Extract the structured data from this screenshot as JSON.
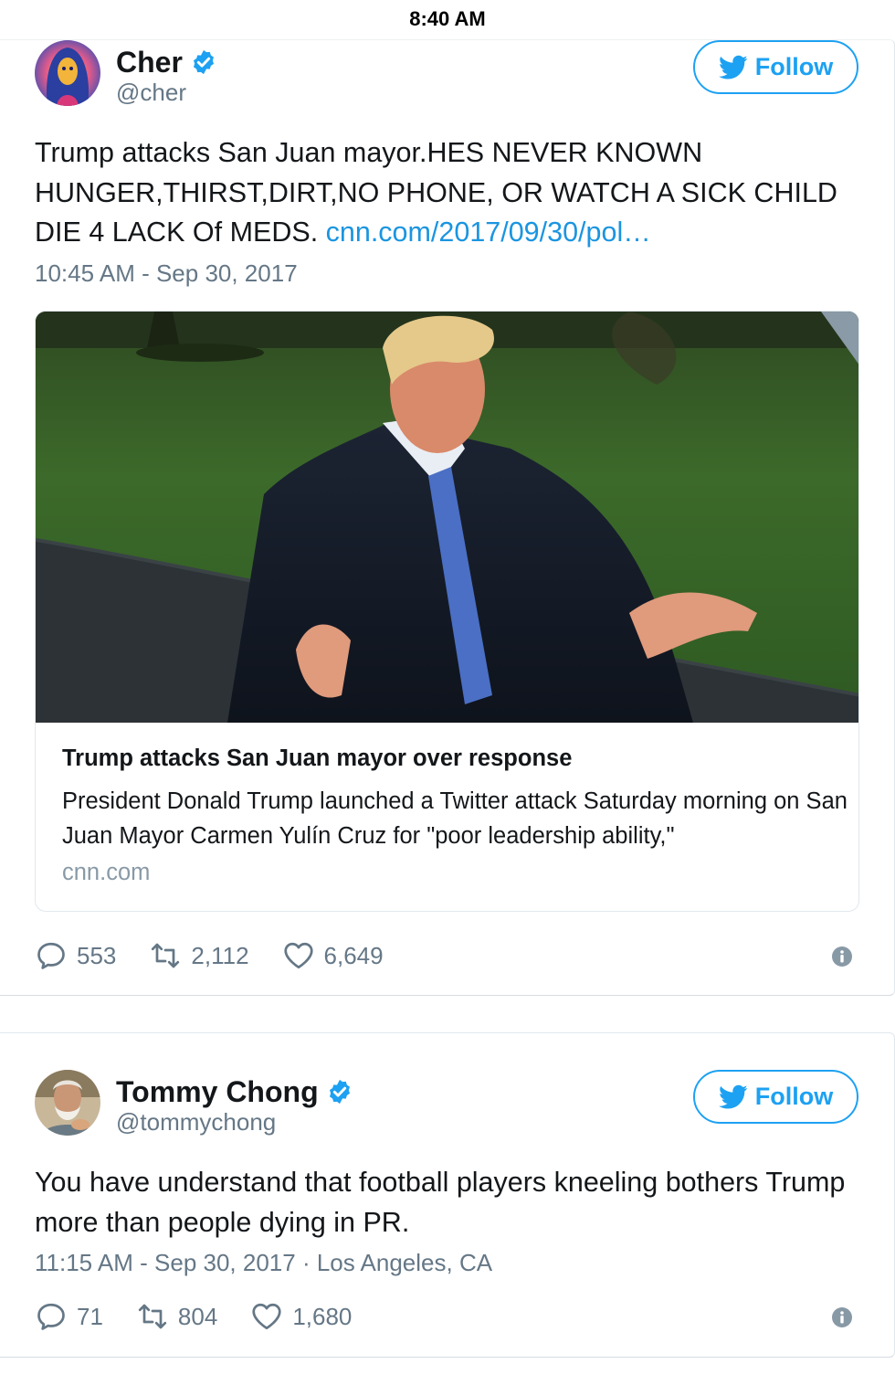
{
  "status_bar": {
    "time": "8:40 AM"
  },
  "colors": {
    "twitter_blue": "#1da1f2",
    "link": "#1b95e0",
    "muted": "#657786"
  },
  "tweets": [
    {
      "author": {
        "name": "Cher",
        "handle": "@cher",
        "verified": true
      },
      "follow_label": "Follow",
      "text": "Trump attacks San Juan mayor.HES NEVER KNOWN HUNGER,THIRST,DIRT,NO PHONE, OR WATCH A SICK CHILD DIE 4 LACK Of MEDS.",
      "link_text": "cnn.com/2017/09/30/pol…",
      "timestamp": "10:45 AM - Sep 30, 2017",
      "card": {
        "title": "Trump attacks San Juan mayor over response",
        "description": "President Donald Trump launched a Twitter attack Saturday morning on San Juan Mayor Carmen Yulín Cruz for \"poor leadership ability,\"",
        "domain": "cnn.com"
      },
      "stats": {
        "replies": "553",
        "retweets": "2,112",
        "likes": "6,649"
      }
    },
    {
      "author": {
        "name": "Tommy Chong",
        "handle": "@tommychong",
        "verified": true
      },
      "follow_label": "Follow",
      "text": "You have understand that football players kneeling bothers Trump more than people dying in PR.",
      "timestamp": "11:15 AM - Sep 30, 2017 · Los Angeles, CA",
      "stats": {
        "replies": "71",
        "retweets": "804",
        "likes": "1,680"
      }
    }
  ]
}
